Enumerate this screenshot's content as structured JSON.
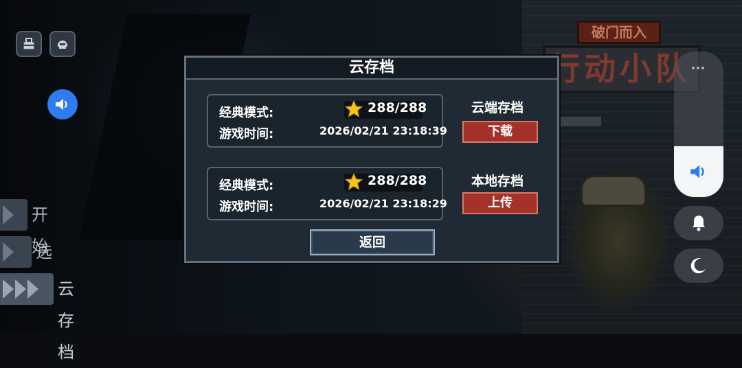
{
  "logo": {
    "subtitle": "破门而入",
    "title": "行动小队"
  },
  "left_menu": {
    "items": [
      {
        "label": "开始"
      },
      {
        "label": "选项"
      },
      {
        "label": "云存档"
      }
    ]
  },
  "dialog": {
    "title": "云存档",
    "slots": [
      {
        "mode_label": "经典模式:",
        "score": "288/288",
        "time_label": "游戏时间:",
        "time": "2026/02/21  23:18:39",
        "side_label": "云端存档",
        "action": "下载"
      },
      {
        "mode_label": "经典模式:",
        "score": "288/288",
        "time_label": "游戏时间:",
        "time": "2026/02/21  23:18:29",
        "side_label": "本地存档",
        "action": "上传"
      }
    ],
    "back": "返回"
  },
  "system_controls": {
    "volume_level": 0.35
  },
  "colors": {
    "accent_blue": "#2f7cf0",
    "action_red": "#a5322a",
    "star_gold": "#f5c518",
    "dialog_bg": "#1f2a34"
  },
  "icons": [
    "inventory-icon",
    "helmet-icon",
    "speaker-icon",
    "star-icon",
    "bell-icon",
    "moon-icon"
  ]
}
